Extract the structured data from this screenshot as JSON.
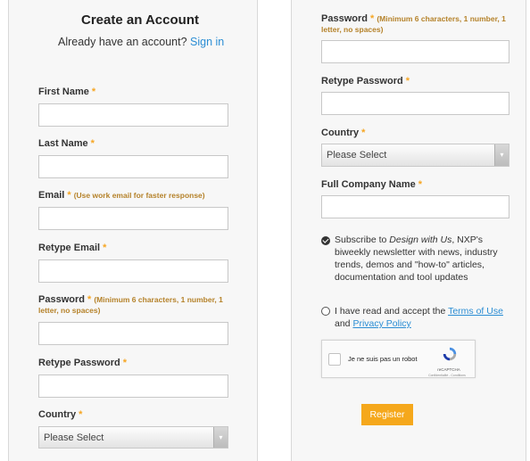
{
  "left": {
    "title": "Create an Account",
    "subtitle": "Already have an account?",
    "signin_link": "Sign in",
    "first_name_label": "First Name",
    "last_name_label": "Last Name",
    "email_label": "Email",
    "email_note": "(Use work email for faster response)",
    "retype_email_label": "Retype Email",
    "password_label": "Password",
    "password_note": "(Minimum 6 characters, 1 number, 1 letter, no spaces)",
    "retype_password_label": "Retype Password",
    "country_label": "Country",
    "country_value": "Please Select"
  },
  "right": {
    "password_label": "Password",
    "password_note": "(Minimum 6 characters, 1 number, 1 letter, no spaces)",
    "retype_password_label": "Retype Password",
    "country_label": "Country",
    "country_value": "Please Select",
    "company_label": "Full Company Name",
    "subscribe_pre": "Subscribe to ",
    "subscribe_em": "Design with Us",
    "subscribe_post": ", NXP's biweekly newsletter with news, industry trends, demos and \"how-to\" articles, documentation and tool updates",
    "subscribe_checked": true,
    "terms_pre": "I have read and accept the ",
    "terms_link": "Terms of Use",
    "terms_mid": " and ",
    "privacy_link": "Privacy Policy",
    "terms_checked": false,
    "captcha_label": "Je ne suis pas un robot",
    "captcha_brand": "reCAPTCHA",
    "captcha_terms": "Confidentialité - Conditions",
    "register_label": "Register"
  },
  "required_marker": "*",
  "select_arrow": "▾",
  "colors": {
    "accent": "#f6a623",
    "link": "#2a8dd4",
    "register_button": "#f5a81c",
    "note": "#b5822a"
  }
}
